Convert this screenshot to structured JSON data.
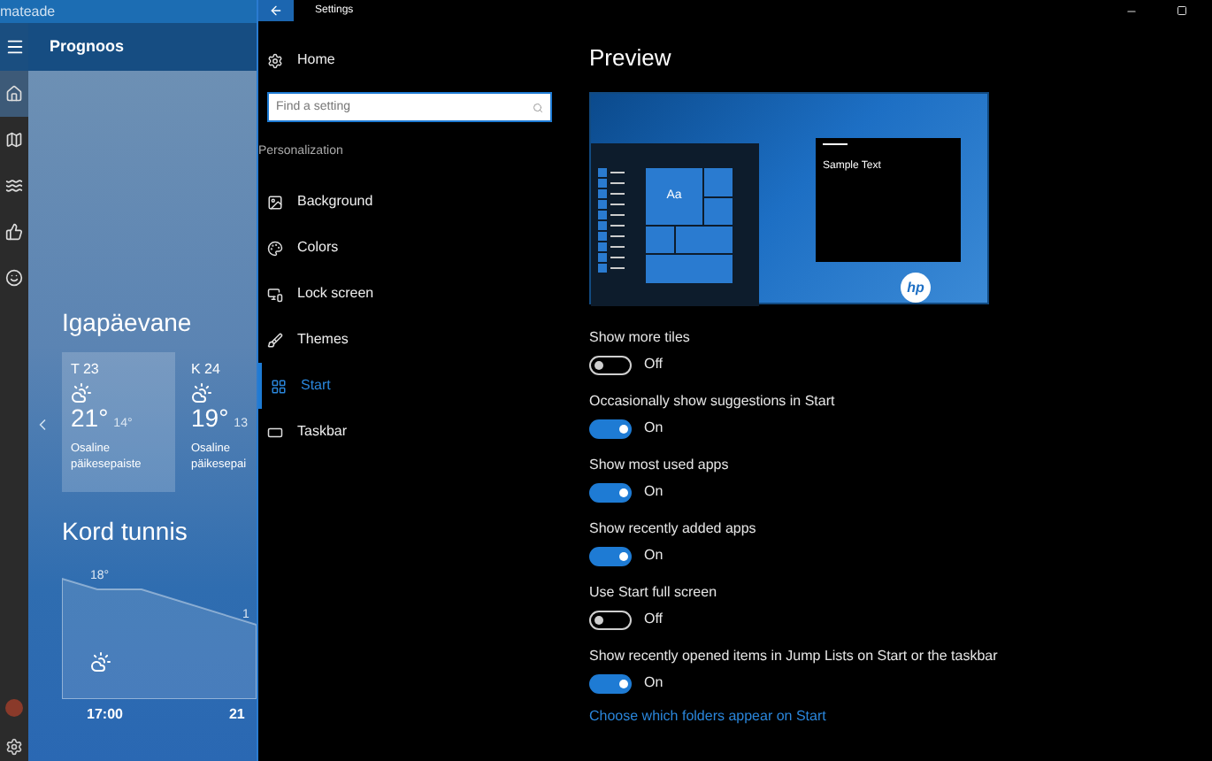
{
  "weather_app": {
    "title": "mateade",
    "header": "Prognoos",
    "rail": [
      {
        "kind": "home",
        "selected": true
      },
      {
        "kind": "maps",
        "selected": false
      },
      {
        "kind": "history",
        "selected": false
      },
      {
        "kind": "life",
        "selected": false
      },
      {
        "kind": "news",
        "selected": false
      }
    ],
    "daily": {
      "title": "Igapäevane",
      "days": [
        {
          "day": "T 23",
          "high": "21°",
          "low": "14°",
          "summary": "Osaline päikesepaiste",
          "selected": true
        },
        {
          "day": "K 24",
          "high": "19°",
          "low": "13",
          "summary": "Osaline päikesepai",
          "selected": false
        }
      ]
    },
    "hourly": {
      "title": "Kord tunnis",
      "temps": [
        "18°",
        "1"
      ],
      "times": [
        "17:00",
        "21"
      ]
    }
  },
  "settings": {
    "window": {
      "title": "Settings"
    },
    "sidebar": {
      "home": "Home",
      "search": {
        "placeholder": "Find a setting"
      },
      "section": "Personalization",
      "items": [
        {
          "label": "Background",
          "kind": "image",
          "selected": false
        },
        {
          "label": "Colors",
          "kind": "palette",
          "selected": false
        },
        {
          "label": "Lock screen",
          "kind": "lock",
          "selected": false
        },
        {
          "label": "Themes",
          "kind": "brush",
          "selected": false
        },
        {
          "label": "Start",
          "kind": "tiles",
          "selected": true
        },
        {
          "label": "Taskbar",
          "kind": "taskbar",
          "selected": false
        }
      ]
    },
    "preview": {
      "title": "Preview",
      "tile_text": "Aa",
      "sample_text": "Sample Text",
      "logo": "hp"
    },
    "toggles": [
      {
        "label": "Show more tiles",
        "on": false,
        "state": "Off"
      },
      {
        "label": "Occasionally show suggestions in Start",
        "on": true,
        "state": "On"
      },
      {
        "label": "Show most used apps",
        "on": true,
        "state": "On"
      },
      {
        "label": "Show recently added apps",
        "on": true,
        "state": "On"
      },
      {
        "label": "Use Start full screen",
        "on": false,
        "state": "Off"
      },
      {
        "label": "Show recently opened items in Jump Lists on Start or the taskbar",
        "on": true,
        "state": "On"
      }
    ],
    "link": "Choose which folders appear on Start"
  }
}
